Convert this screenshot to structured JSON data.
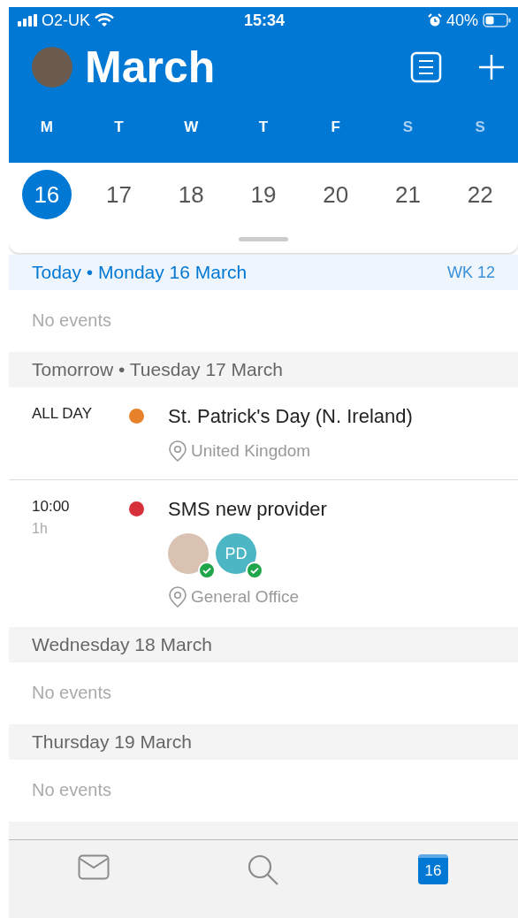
{
  "status_bar": {
    "carrier": "O2-UK",
    "time": "15:34",
    "battery": "40%"
  },
  "header": {
    "title": "March"
  },
  "weekdays": [
    {
      "label": "M",
      "weekend": false
    },
    {
      "label": "T",
      "weekend": false
    },
    {
      "label": "W",
      "weekend": false
    },
    {
      "label": "T",
      "weekend": false
    },
    {
      "label": "F",
      "weekend": false
    },
    {
      "label": "S",
      "weekend": true
    },
    {
      "label": "S",
      "weekend": true
    }
  ],
  "dates": [
    {
      "label": "16",
      "selected": true
    },
    {
      "label": "17",
      "selected": false
    },
    {
      "label": "18",
      "selected": false
    },
    {
      "label": "19",
      "selected": false
    },
    {
      "label": "20",
      "selected": false
    },
    {
      "label": "21",
      "selected": false
    },
    {
      "label": "22",
      "selected": false
    }
  ],
  "agenda": [
    {
      "heading": "Today • Monday 16 March",
      "today": true,
      "week": "WK 12",
      "empty_text": "No events"
    },
    {
      "heading": "Tomorrow • Tuesday 17 March",
      "today": false,
      "events": [
        {
          "time": "ALL DAY",
          "title": "St. Patrick's Day (N. Ireland)",
          "color": "#e8822a",
          "location": "United Kingdom"
        },
        {
          "time": "10:00",
          "duration": "1h",
          "title": "SMS new provider",
          "color": "#d8303a",
          "location": "General Office",
          "attendees": [
            {
              "kind": "photo",
              "accepted": true
            },
            {
              "kind": "initials",
              "initials": "PD",
              "accepted": true
            }
          ]
        }
      ]
    },
    {
      "heading": "Wednesday 18 March",
      "today": false,
      "empty_text": "No events"
    },
    {
      "heading": "Thursday 19 March",
      "today": false,
      "empty_text": "No events"
    }
  ],
  "tab_bar": [
    {
      "kind": "mail",
      "selected": false
    },
    {
      "kind": "search",
      "selected": false
    },
    {
      "kind": "calendar",
      "label": "16",
      "selected": true
    }
  ]
}
